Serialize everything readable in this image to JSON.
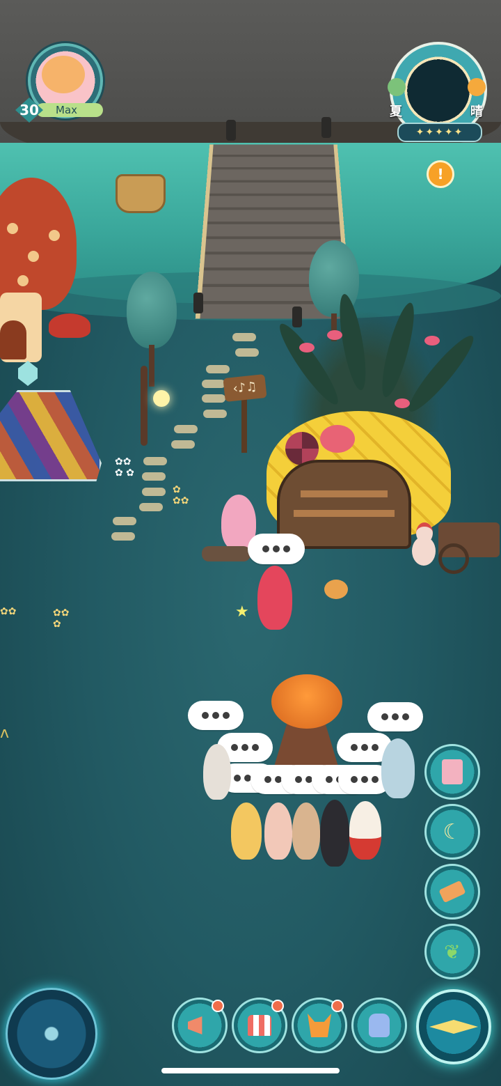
{
  "player": {
    "level": "30",
    "name": "Max"
  },
  "season_panel": {
    "season": "夏",
    "weather": "晴",
    "stars": "✦✦✦✦✦"
  },
  "alert": {
    "symbol": "!"
  },
  "sign": {
    "text": "‹♪♫"
  },
  "thought_bubble": {
    "dots": "•••"
  },
  "side_buttons": [
    {
      "icon": "book-tulip-icon"
    },
    {
      "icon": "wardrobe-moon-icon"
    },
    {
      "icon": "hammer-icon"
    },
    {
      "icon": "sprout-icon"
    }
  ],
  "bottom_buttons": [
    {
      "icon": "megaphone-icon"
    },
    {
      "icon": "shop-icon"
    },
    {
      "icon": "fox-friend-icon"
    },
    {
      "icon": "backpack-icon"
    }
  ],
  "colors": {
    "accent": "#2fa6aa",
    "badge": "#ef6d4a",
    "water": "#3aa79b",
    "ground": "#225a63"
  }
}
